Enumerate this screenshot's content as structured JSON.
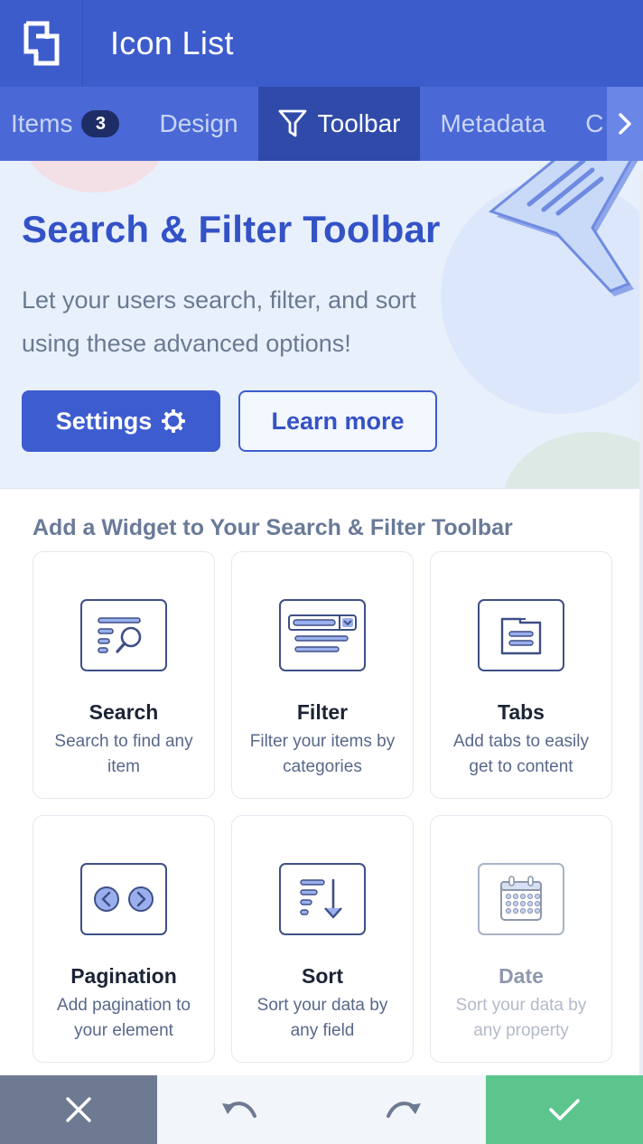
{
  "header": {
    "title": "Icon List",
    "logo_icon": "logo-icon"
  },
  "tabs": [
    {
      "label": "Items",
      "badge": "3",
      "active": false
    },
    {
      "label": "Design",
      "active": false
    },
    {
      "label": "Toolbar",
      "icon": "funnel-icon",
      "active": true
    },
    {
      "label": "Metadata",
      "active": false
    },
    {
      "label": "C",
      "active": false
    }
  ],
  "hero": {
    "title": "Search & Filter Toolbar",
    "description": "Let your users search, filter, and sort using these advanced options!",
    "settings_label": "Settings",
    "learn_more_label": "Learn more"
  },
  "widgets": {
    "section_title": "Add a Widget to Your Search & Filter Toolbar",
    "items": [
      {
        "title": "Search",
        "desc": "Search to find any item",
        "icon": "search-widget-icon",
        "enabled": true
      },
      {
        "title": "Filter",
        "desc": "Filter your items by categories",
        "icon": "filter-widget-icon",
        "enabled": true
      },
      {
        "title": "Tabs",
        "desc": "Add tabs to easily get to content",
        "icon": "tabs-widget-icon",
        "enabled": true
      },
      {
        "title": "Pagination",
        "desc": "Add pagination to your element",
        "icon": "pagination-widget-icon",
        "enabled": true
      },
      {
        "title": "Sort",
        "desc": "Sort your data by any field",
        "icon": "sort-widget-icon",
        "enabled": true
      },
      {
        "title": "Date",
        "desc": "Sort your data by any property",
        "icon": "calendar-widget-icon",
        "enabled": false
      }
    ]
  },
  "bottom_bar": {
    "cancel_icon": "close-icon",
    "undo_icon": "undo-icon",
    "redo_icon": "redo-icon",
    "confirm_icon": "check-icon"
  },
  "colors": {
    "header": "#3d5ccc",
    "tabs": "#4a69d6",
    "active_tab": "#2f4aa8",
    "accent": "#3d5cd0",
    "confirm": "#5cc58e",
    "cancel": "#6e7a91"
  }
}
